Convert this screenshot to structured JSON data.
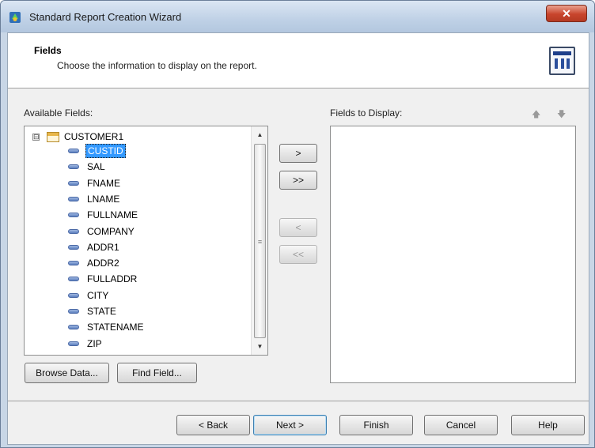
{
  "window": {
    "title": "Standard Report Creation Wizard",
    "close_glyph": "✕"
  },
  "header": {
    "title": "Fields",
    "subtitle": "Choose the information to display on the report.",
    "icon": "table-columns-icon"
  },
  "available": {
    "label": "Available Fields:",
    "root": {
      "label": "CUSTOMER1",
      "expander": "⊟",
      "icon": "table-icon"
    },
    "fields": [
      "CUSTID",
      "SAL",
      "FNAME",
      "LNAME",
      "FULLNAME",
      "COMPANY",
      "ADDR1",
      "ADDR2",
      "FULLADDR",
      "CITY",
      "STATE",
      "STATENAME",
      "ZIP"
    ],
    "selected": "CUSTID",
    "field_icon": "field-icon",
    "scroll_up": "▲",
    "scroll_down": "▼",
    "scroll_grip": "≡"
  },
  "display": {
    "label": "Fields to Display:",
    "move_up": "🡅",
    "move_down": "🡇"
  },
  "transfer": {
    "add": ">",
    "add_all": ">>",
    "remove": "<",
    "remove_all": "<<"
  },
  "left_buttons": {
    "browse": "Browse Data...",
    "find": "Find Field..."
  },
  "footer": {
    "back": "< Back",
    "next": "Next >",
    "finish": "Finish",
    "cancel": "Cancel",
    "help": "Help"
  },
  "colors": {
    "selection": "#3399ff",
    "close_button": "#c8452d"
  }
}
